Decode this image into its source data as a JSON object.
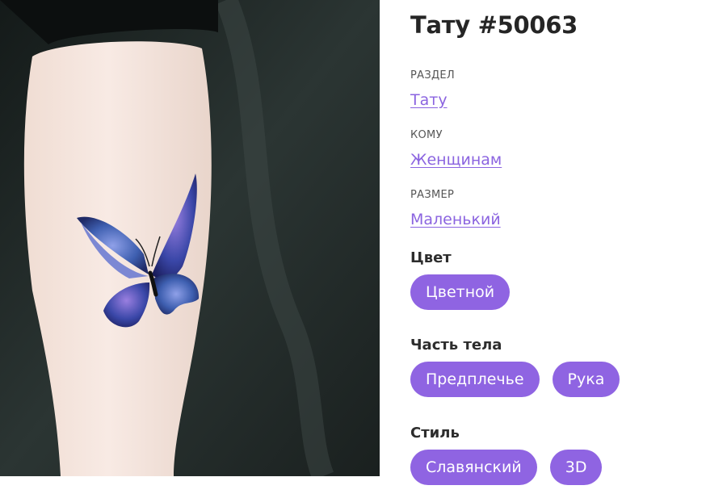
{
  "tattoo": {
    "title": "Тату #50063",
    "image_alt": "Tattoo photo: blue-violet butterfly on forearm"
  },
  "meta": [
    {
      "label": "РАЗДЕЛ",
      "value": "Тату"
    },
    {
      "label": "КОМУ",
      "value": "Женщинам"
    },
    {
      "label": "РАЗМЕР",
      "value": "Маленький"
    }
  ],
  "sections": [
    {
      "title": "Цвет",
      "tags": [
        "Цветной"
      ]
    },
    {
      "title": "Часть тела",
      "tags": [
        "Предплечье",
        "Рука"
      ]
    },
    {
      "title": "Стиль",
      "tags": [
        "Славянский",
        "3D"
      ]
    }
  ],
  "colors": {
    "accent": "#8f64e2",
    "link": "#8b64e0",
    "chip_text": "#ffffff"
  }
}
